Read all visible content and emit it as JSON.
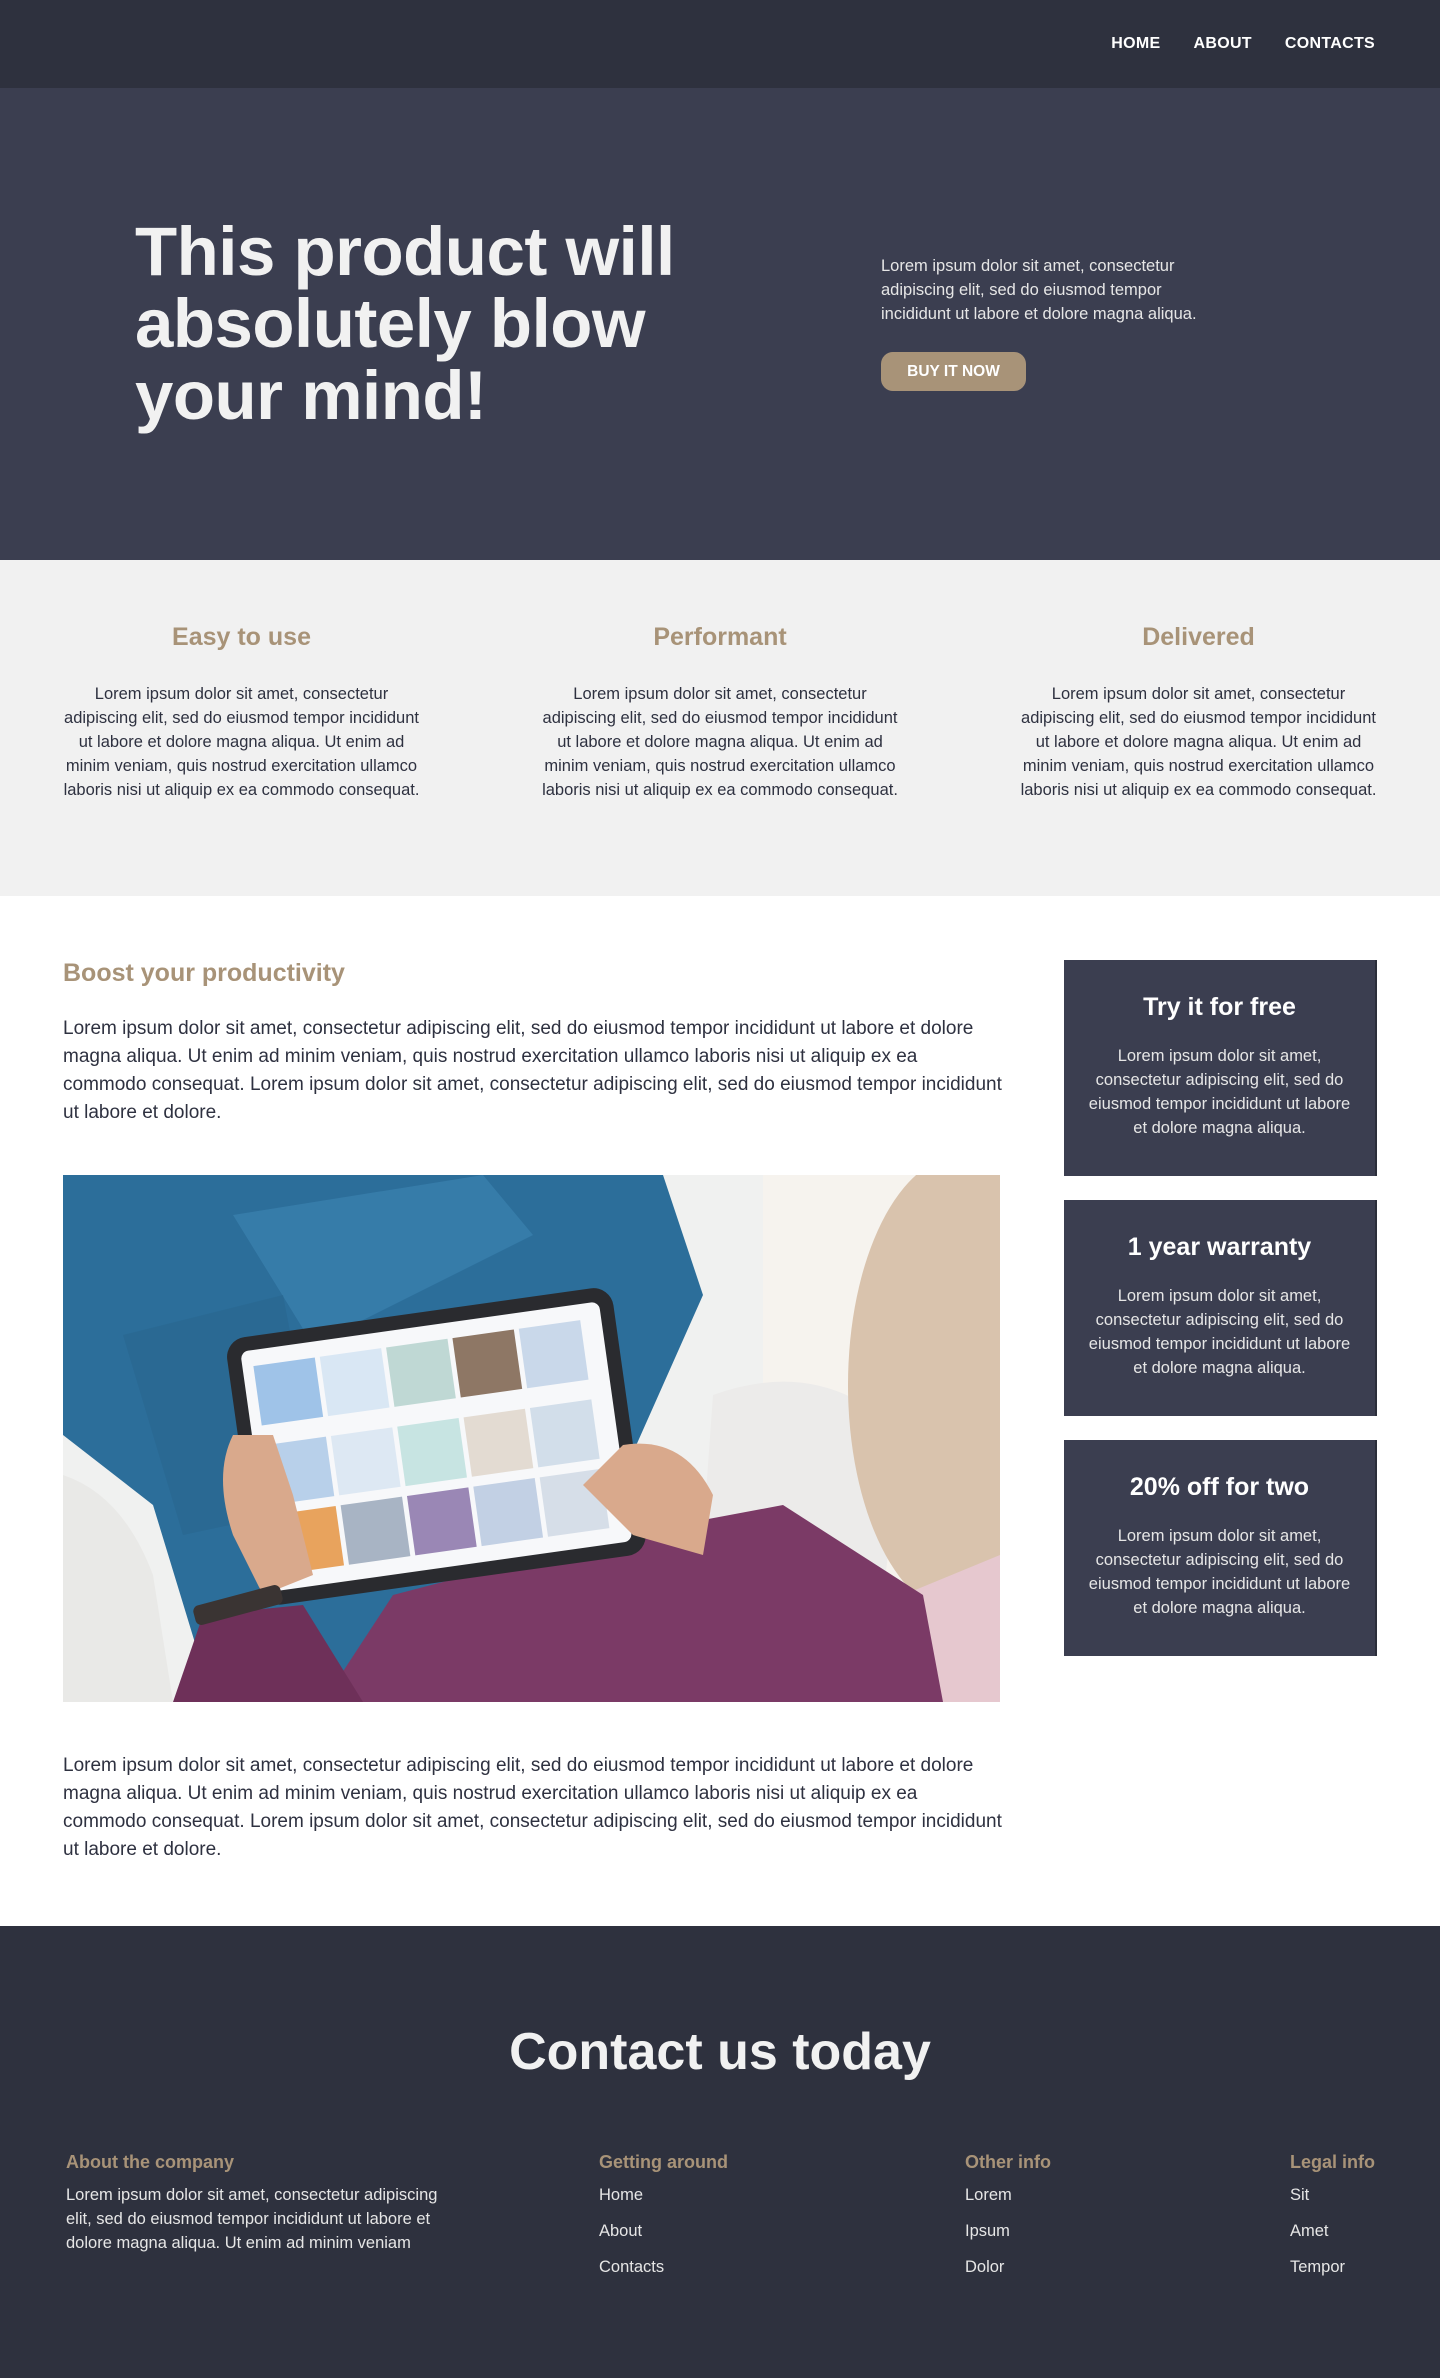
{
  "nav": {
    "links": [
      "HOME",
      "ABOUT",
      "CONTACTS"
    ]
  },
  "hero": {
    "title": "This product will absolutely blow your mind!",
    "text": "Lorem ipsum dolor sit amet, consectetur adipiscing elit, sed do eiusmod tempor incididunt ut labore et dolore magna aliqua.",
    "button": "BUY IT NOW"
  },
  "features": [
    {
      "title": "Easy to use",
      "text": "Lorem ipsum dolor sit amet, consectetur adipiscing elit, sed do eiusmod tempor incididunt ut labore et dolore magna aliqua. Ut enim ad minim veniam, quis nostrud exercitation ullamco laboris nisi ut aliquip ex ea commodo consequat."
    },
    {
      "title": "Performant",
      "text": "Lorem ipsum dolor sit amet, consectetur adipiscing elit, sed do eiusmod tempor incididunt ut labore et dolore magna aliqua. Ut enim ad minim veniam, quis nostrud exercitation ullamco laboris nisi ut aliquip ex ea commodo consequat."
    },
    {
      "title": "Delivered",
      "text": "Lorem ipsum dolor sit amet, consectetur adipiscing elit, sed do eiusmod tempor incididunt ut labore et dolore magna aliqua. Ut enim ad minim veniam, quis nostrud exercitation ullamco laboris nisi ut aliquip ex ea commodo consequat."
    }
  ],
  "main": {
    "heading": "Boost your productivity",
    "paragraph1": "Lorem ipsum dolor sit amet, consectetur adipiscing elit, sed do eiusmod tempor incididunt ut labore et dolore magna aliqua. Ut enim ad minim veniam, quis nostrud exercitation ullamco laboris nisi ut aliquip ex ea commodo consequat. Lorem ipsum dolor sit amet, consectetur adipiscing elit, sed do eiusmod tempor incididunt ut labore et dolore.",
    "paragraph2": "Lorem ipsum dolor sit amet, consectetur adipiscing elit, sed do eiusmod tempor incididunt ut labore et dolore magna aliqua. Ut enim ad minim veniam, quis nostrud exercitation ullamco laboris nisi ut aliquip ex ea commodo consequat. Lorem ipsum dolor sit amet, consectetur adipiscing elit, sed do eiusmod tempor incididunt ut labore et dolore."
  },
  "sidebar": [
    {
      "title": "Try it for free",
      "text": "Lorem ipsum dolor sit amet, consectetur adipiscing elit, sed do eiusmod tempor incididunt ut labore et dolore magna aliqua."
    },
    {
      "title": "1 year warranty",
      "text": "Lorem ipsum dolor sit amet, consectetur adipiscing elit, sed do eiusmod tempor incididunt ut labore et dolore magna aliqua."
    },
    {
      "title": "20% off for two",
      "text": "Lorem ipsum dolor sit amet, consectetur adipiscing elit, sed do eiusmod tempor incididunt ut labore et dolore magna aliqua."
    }
  ],
  "footer": {
    "title": "Contact us today",
    "about": {
      "title": "About the company",
      "text": "Lorem ipsum dolor sit amet, consectetur adipiscing elit, sed do eiusmod tempor incididunt ut labore et dolore magna aliqua. Ut enim ad minim veniam"
    },
    "getting_around": {
      "title": "Getting around",
      "links": [
        "Home",
        "About",
        "Contacts"
      ]
    },
    "other_info": {
      "title": "Other info",
      "links": [
        "Lorem",
        "Ipsum",
        "Dolor"
      ]
    },
    "legal_info": {
      "title": "Legal info",
      "links": [
        "Sit",
        "Amet",
        "Tempor"
      ]
    }
  },
  "colors": {
    "nav_bg": "#2e313e",
    "hero_bg": "#3b3e50",
    "accent": "#a89378",
    "features_bg": "#f1f1f1",
    "footer_bg": "#2e313e"
  }
}
